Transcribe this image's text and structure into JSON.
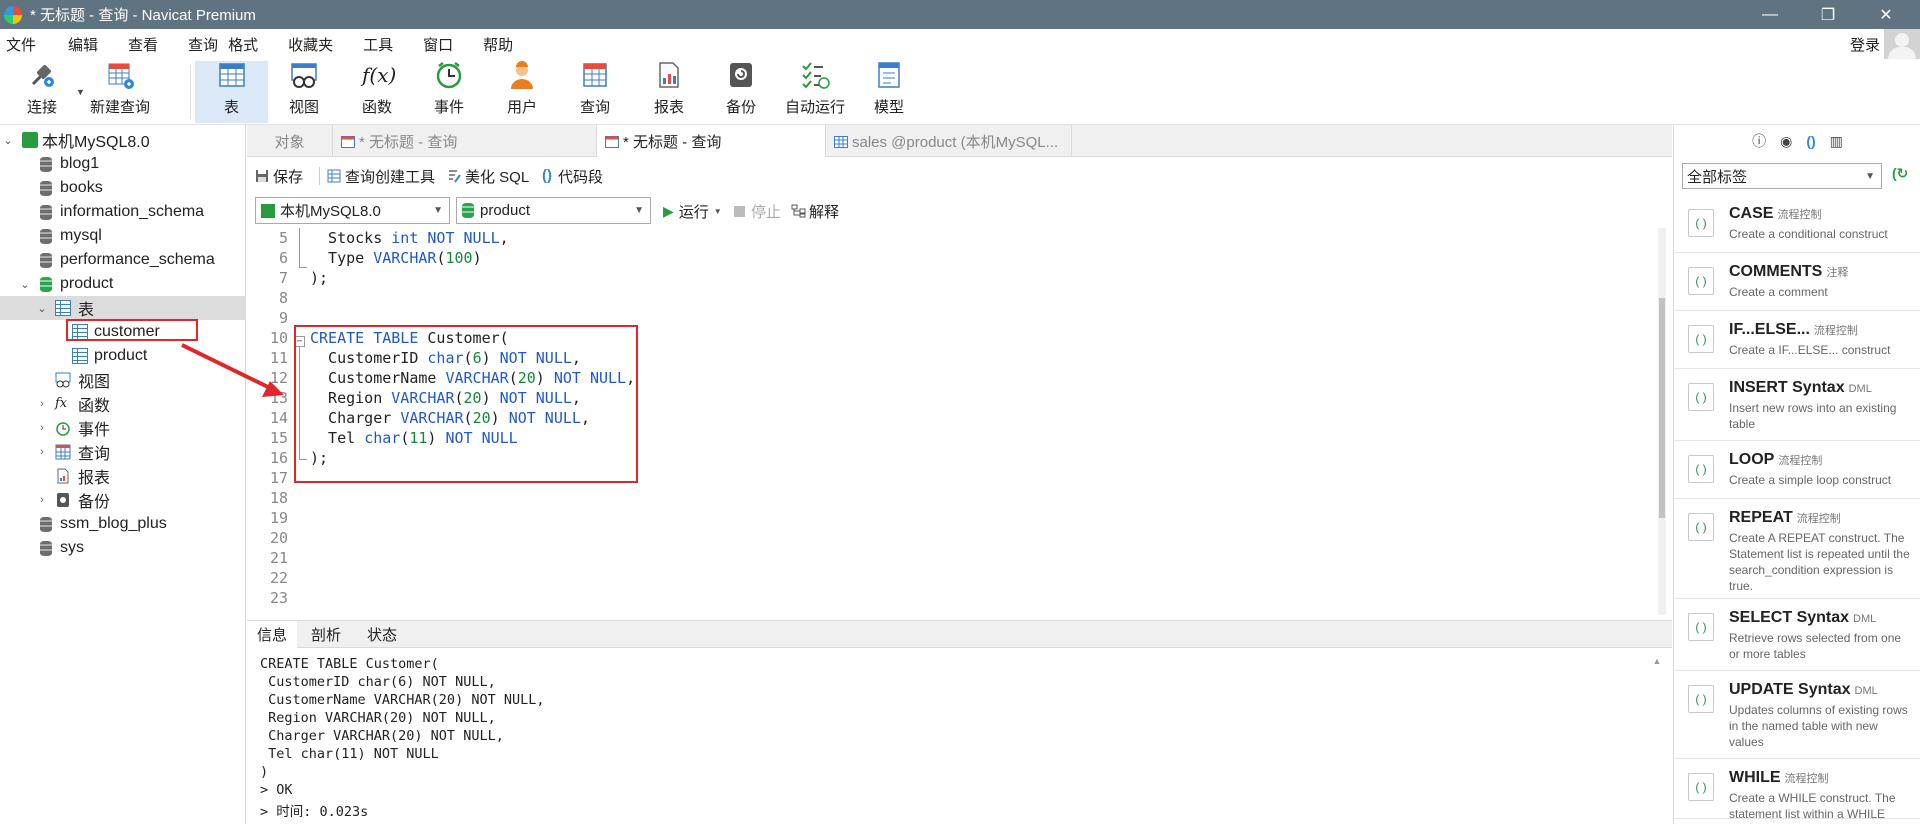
{
  "window": {
    "title": "* 无标题 - 查询 - Navicat Premium",
    "minimize": "—",
    "maximize": "❐",
    "close": "✕"
  },
  "menu": {
    "items": [
      "文件",
      "编辑",
      "查看",
      "查询",
      "格式",
      "收藏夹",
      "工具",
      "窗口",
      "帮助"
    ],
    "login": "登录"
  },
  "toolbar": {
    "buttons": [
      "连接",
      "新建查询",
      "表",
      "视图",
      "函数",
      "事件",
      "用户",
      "查询",
      "报表",
      "备份",
      "自动运行",
      "模型"
    ],
    "func_glyph": "f(x)"
  },
  "tree": {
    "connection": "本机MySQL8.0",
    "databases_top": [
      "blog1",
      "books",
      "information_schema",
      "mysql",
      "performance_schema"
    ],
    "product_db": "product",
    "tables_folder": "表",
    "tables": [
      "customer",
      "product"
    ],
    "folders": [
      "视图",
      "函数",
      "事件",
      "查询",
      "报表",
      "备份"
    ],
    "databases_bottom": [
      "ssm_blog_plus",
      "sys"
    ]
  },
  "tabs": {
    "objects": "对象",
    "untitled_1": "* 无标题 - 查询",
    "untitled_2": "* 无标题 - 查询",
    "sales": "sales @product (本机MySQL..."
  },
  "query_toolbar": {
    "save": "保存",
    "builder": "查询创建工具",
    "beautify": "美化 SQL",
    "snippet": "代码段",
    "run": "运行",
    "stop": "停止",
    "explain": "解释"
  },
  "selectors": {
    "connection": "本机MySQL8.0",
    "database": "product"
  },
  "editor": {
    "line_numbers": [
      "5",
      "6",
      "7",
      "8",
      "9",
      "10",
      "11",
      "12",
      "13",
      "14",
      "15",
      "16",
      "17",
      "18",
      "19",
      "20",
      "21",
      "22",
      "23"
    ],
    "lines": [
      [
        {
          "t": "  Stocks "
        },
        {
          "t": "int",
          "c": "kw"
        },
        {
          "t": " "
        },
        {
          "t": "NOT NULL",
          "c": "kw"
        },
        {
          "t": ","
        }
      ],
      [
        {
          "t": "  Type "
        },
        {
          "t": "VARCHAR",
          "c": "kw"
        },
        {
          "t": "("
        },
        {
          "t": "100",
          "c": "num"
        },
        {
          "t": ")"
        }
      ],
      [
        {
          "t": ");"
        }
      ],
      [
        {
          "t": ""
        }
      ],
      [
        {
          "t": ""
        }
      ],
      [
        {
          "t": "CREATE TABLE",
          "c": "kw"
        },
        {
          "t": " Customer("
        }
      ],
      [
        {
          "t": "  CustomerID "
        },
        {
          "t": "char",
          "c": "kw"
        },
        {
          "t": "("
        },
        {
          "t": "6",
          "c": "num"
        },
        {
          "t": ") "
        },
        {
          "t": "NOT NULL",
          "c": "kw"
        },
        {
          "t": ","
        }
      ],
      [
        {
          "t": "  CustomerName "
        },
        {
          "t": "VARCHAR",
          "c": "kw"
        },
        {
          "t": "("
        },
        {
          "t": "20",
          "c": "num"
        },
        {
          "t": ") "
        },
        {
          "t": "NOT NULL",
          "c": "kw"
        },
        {
          "t": ","
        }
      ],
      [
        {
          "t": "  Region "
        },
        {
          "t": "VARCHAR",
          "c": "kw"
        },
        {
          "t": "("
        },
        {
          "t": "20",
          "c": "num"
        },
        {
          "t": ") "
        },
        {
          "t": "NOT NULL",
          "c": "kw"
        },
        {
          "t": ","
        }
      ],
      [
        {
          "t": "  Charger "
        },
        {
          "t": "VARCHAR",
          "c": "kw"
        },
        {
          "t": "("
        },
        {
          "t": "20",
          "c": "num"
        },
        {
          "t": ") "
        },
        {
          "t": "NOT NULL",
          "c": "kw"
        },
        {
          "t": ","
        }
      ],
      [
        {
          "t": "  Tel "
        },
        {
          "t": "char",
          "c": "kw"
        },
        {
          "t": "("
        },
        {
          "t": "11",
          "c": "num"
        },
        {
          "t": ") "
        },
        {
          "t": "NOT NULL",
          "c": "kw"
        }
      ],
      [
        {
          "t": ");"
        }
      ],
      [
        {
          "t": ""
        }
      ],
      [
        {
          "t": ""
        }
      ],
      [
        {
          "t": ""
        }
      ],
      [
        {
          "t": ""
        }
      ],
      [
        {
          "t": ""
        }
      ],
      [
        {
          "t": ""
        }
      ],
      [
        {
          "t": ""
        }
      ]
    ]
  },
  "bottom_tabs": [
    "信息",
    "剖析",
    "状态"
  ],
  "output": {
    "lines": [
      "CREATE TABLE Customer(",
      " CustomerID char(6) NOT NULL,",
      " CustomerName VARCHAR(20) NOT NULL,",
      " Region VARCHAR(20) NOT NULL,",
      " Charger VARCHAR(20) NOT NULL,",
      " Tel char(11) NOT NULL",
      ")",
      "> OK",
      "> 时间: 0.023s"
    ]
  },
  "right_panel": {
    "filter": "全部标签",
    "snippets": [
      {
        "name": "CASE",
        "tag": "流程控制",
        "desc": "Create a conditional construct"
      },
      {
        "name": "COMMENTS",
        "tag": "注释",
        "desc": "Create a comment"
      },
      {
        "name": "IF...ELSE...",
        "tag": "流程控制",
        "desc": "Create a IF...ELSE... construct"
      },
      {
        "name": "INSERT Syntax",
        "tag": "DML",
        "desc": "Insert new rows into an existing table"
      },
      {
        "name": "LOOP",
        "tag": "流程控制",
        "desc": "Create a simple loop construct"
      },
      {
        "name": "REPEAT",
        "tag": "流程控制",
        "desc": "Create A REPEAT construct. The Statement list is repeated until the search_condition expression is true."
      },
      {
        "name": "SELECT Syntax",
        "tag": "DML",
        "desc": "Retrieve rows selected from one or more tables"
      },
      {
        "name": "UPDATE Syntax",
        "tag": "DML",
        "desc": "Updates columns of existing rows in the named table with new values"
      },
      {
        "name": "WHILE",
        "tag": "流程控制",
        "desc": "Create a WHILE construct. The statement list within a WHILE"
      }
    ]
  },
  "colors": {
    "titlebar": "#5f7381",
    "keyword": "#2158cf",
    "number": "#12893a",
    "highlight": "#e0262b",
    "toolbar_active": "#dbe8f5"
  }
}
